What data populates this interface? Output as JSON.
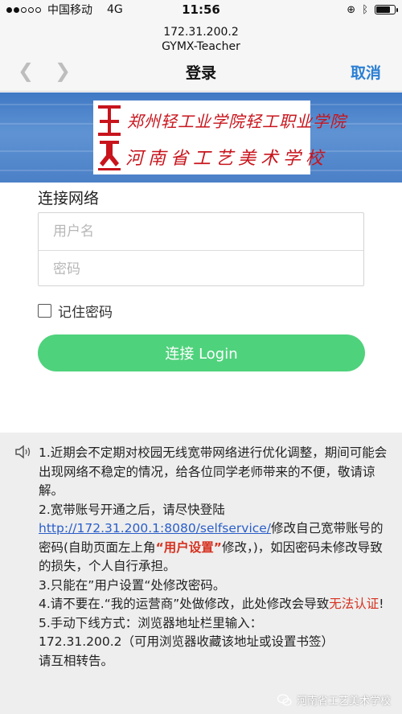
{
  "status_bar": {
    "carrier": "中国移动",
    "network": "4G",
    "time": "11:56"
  },
  "browser": {
    "address_line1": "172.31.200.2",
    "address_line2": "GYMX-Teacher",
    "back_icon": "chevron-left-icon",
    "forward_icon": "chevron-right-icon",
    "title": "登录",
    "cancel_label": "取消"
  },
  "banner": {
    "logo_line1": "郑州轻工业学院轻工职业学院",
    "logo_line2": "河南省工艺美术学校",
    "colors": {
      "background": "#4a82c8",
      "logo_red": "#c8141c"
    }
  },
  "login": {
    "title": "连接网络",
    "username_placeholder": "用户名",
    "password_placeholder": "密码",
    "remember_label": "记住密码",
    "remember_checked": false,
    "button_label": "连接 Login",
    "button_color": "#4fd27c"
  },
  "notice": {
    "icon": "speaker-icon",
    "item1": "1.近期会不定期对校园无线宽带网络进行优化调整，期间可能会出现网络不稳定的情况，给各位同学老师带来的不便，敬请谅解。",
    "item2_prefix": "2.宽带账号开通之后，请尽快登陆",
    "item2_link": "http://172.31.200.1:8080/selfservice/",
    "item2_middle": "修改自己宽带账号的密码(自助页面左上角",
    "item2_highlight": "“用户设置”",
    "item2_suffix": "修改，)，如因密码未修改导致的损失，个人自行承担。",
    "item3": "3.只能在”用户设置“处修改密码。",
    "item4_prefix": "4.请不要在.“我的运营商”处做修改，此处修改会导致",
    "item4_highlight": "无法认证",
    "item4_suffix": "!",
    "item5_line1": "5.手动下线方式：浏览器地址栏里输入：",
    "item5_line2": "172.31.200.2（可用浏览器收藏该地址或设置书签）",
    "item5_line3": "请互相转告。"
  },
  "watermark": {
    "text": "河南省工艺美术学校",
    "icon": "wechat-icon"
  }
}
